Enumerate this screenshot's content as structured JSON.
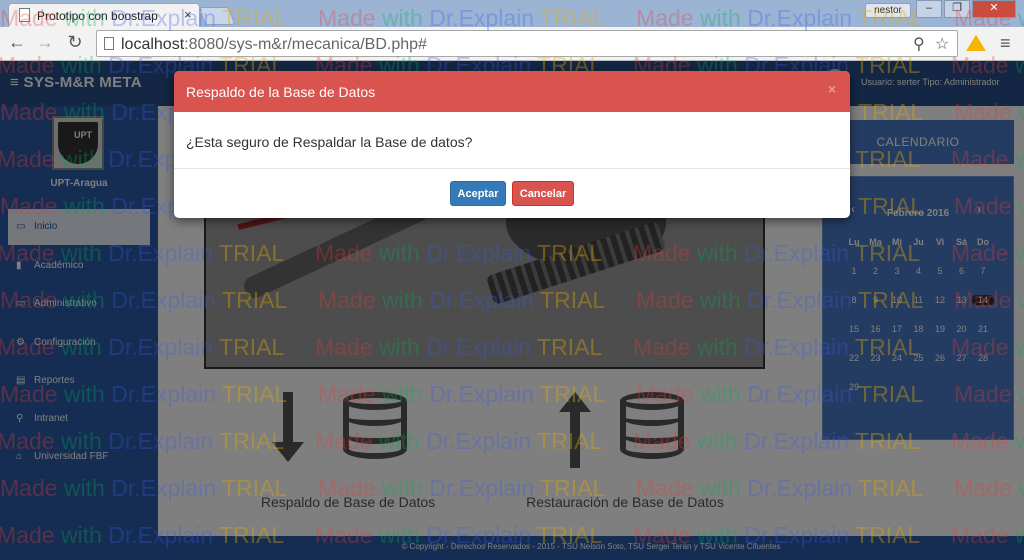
{
  "browser": {
    "tab_title": "Prototipo con boostrap",
    "tab_close": "×",
    "user_chip": "nestor",
    "window_minimize": "–",
    "window_maximize": "❐",
    "window_close": "✕",
    "url_host": "localhost",
    "url_path": ":8080/sys-m&r/mecanica/BD.php#",
    "back": "←",
    "forward": "→",
    "reload": "↻",
    "zoom_icon": "⚲",
    "star_icon": "☆",
    "menu_icon": "≡"
  },
  "app": {
    "brand": "SYS-M&R  META",
    "menu_toggle": "≡",
    "header_user": "Usuario: serter   Tipo: Administrador",
    "logo_text": "UPT",
    "university": "UPT-Aragua",
    "sidebar": [
      {
        "icon": "▭",
        "label": "Inicio"
      },
      {
        "icon": "▮",
        "label": "Académico"
      },
      {
        "icon": "▭",
        "label": "Administrativo"
      },
      {
        "icon": "⚙",
        "label": "Configuración"
      },
      {
        "icon": "▤",
        "label": "Reportes"
      },
      {
        "icon": "⚲",
        "label": "Intranet"
      },
      {
        "icon": "⌂",
        "label": "Universidad FBF"
      }
    ],
    "backup_label": "Respaldo de Base de Datos",
    "restore_label": "Restauración de Base de Datos",
    "footer": "© Copyright - Derechos Reservados - 2015 - TSU Nelson Soto, TSU Sergei Terán y TSU Vicente Cifuentes"
  },
  "calendar": {
    "header": "CALENDARIO",
    "prev": "‹",
    "next": "›",
    "month": "Febrero 2016",
    "weekdays": [
      "Lu",
      "Ma",
      "Mi",
      "Ju",
      "Vi",
      "Sá",
      "Do"
    ],
    "days": [
      "1",
      "2",
      "3",
      "4",
      "5",
      "6",
      "7",
      "8",
      "9",
      "10",
      "11",
      "12",
      "13",
      "14",
      "15",
      "16",
      "17",
      "18",
      "19",
      "20",
      "21",
      "22",
      "23",
      "24",
      "25",
      "26",
      "27",
      "28",
      "29"
    ],
    "today": "14"
  },
  "modal": {
    "title": "Respaldo de la Base de Datos",
    "close": "×",
    "message": "¿Esta seguro de Respaldar la Base de datos?",
    "accept": "Aceptar",
    "cancel": "Cancelar"
  },
  "watermark": {
    "made": "Made ",
    "with": "with ",
    "brand": "Dr.Explain ",
    "trial": "TRIAL"
  },
  "colors": {
    "modal_header": "#d9534f",
    "accept_button": "#337ab7",
    "cancel_button": "#d9534f",
    "app_primary": "#2b5aa5"
  }
}
